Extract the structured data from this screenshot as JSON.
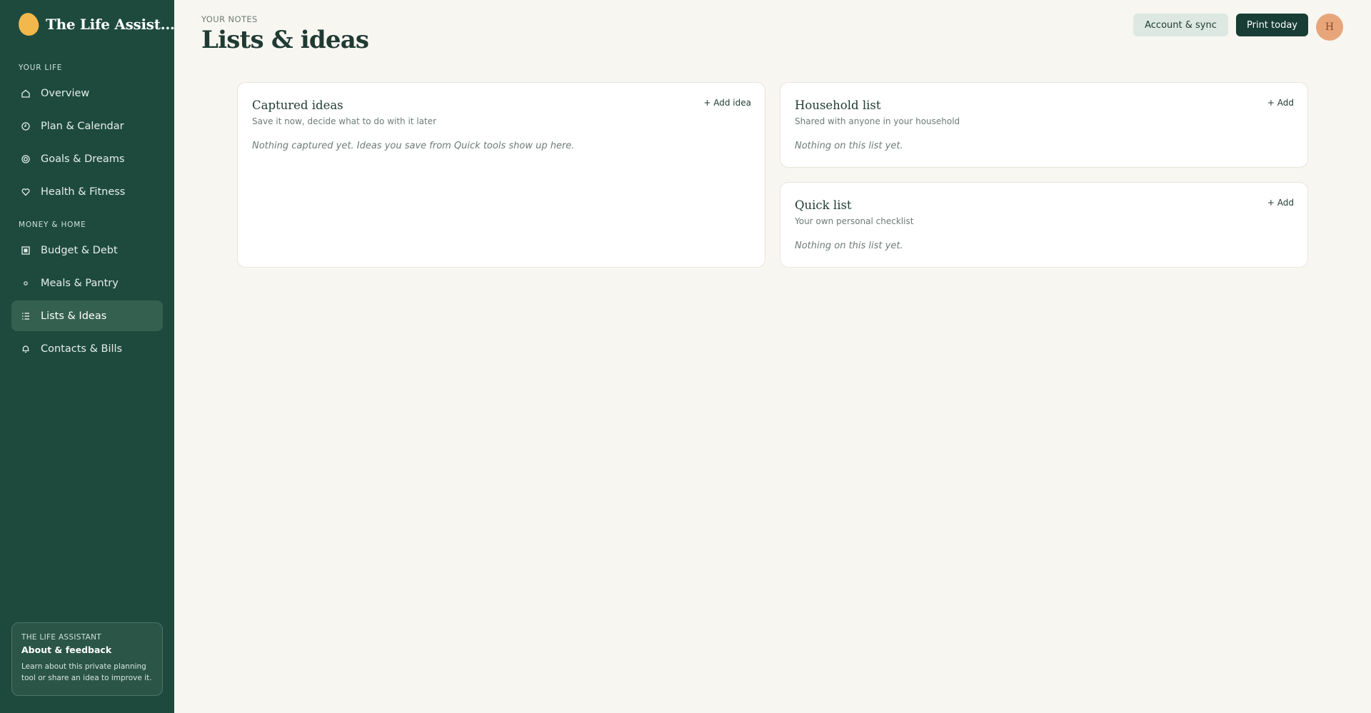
{
  "brand": {
    "name": "The Life Assist..."
  },
  "sidebar": {
    "section_life": "YOUR LIFE",
    "section_money": "MONEY & HOME",
    "items": [
      {
        "label": "Overview",
        "icon": "home-icon"
      },
      {
        "label": "Plan & Calendar",
        "icon": "clock-icon"
      },
      {
        "label": "Goals & Dreams",
        "icon": "target-icon"
      },
      {
        "label": "Health & Fitness",
        "icon": "heart-icon"
      },
      {
        "label": "Budget & Debt",
        "icon": "wallet-icon"
      },
      {
        "label": "Meals & Pantry",
        "icon": "circle-icon"
      },
      {
        "label": "Lists & Ideas",
        "icon": "list-icon",
        "active": true
      },
      {
        "label": "Contacts & Bills",
        "icon": "bell-icon"
      }
    ],
    "about": {
      "kicker": "THE LIFE ASSISTANT",
      "title": "About & feedback",
      "text": "Learn about this private planning tool or share an idea to improve it."
    }
  },
  "header": {
    "kicker": "YOUR NOTES",
    "title": "Lists & ideas",
    "account_label": "Account & sync",
    "print_label": "Print today",
    "avatar_initial": "H"
  },
  "cards": {
    "captured": {
      "title": "Captured ideas",
      "subtitle": "Save it now, decide what to do with it later",
      "empty": "Nothing captured yet. Ideas you save from Quick tools show up here.",
      "add_label": "+ Add idea"
    },
    "household": {
      "title": "Household list",
      "subtitle": "Shared with anyone in your household",
      "empty": "Nothing on this list yet.",
      "add_label": "+ Add"
    },
    "quick": {
      "title": "Quick list",
      "subtitle": "Your own personal checklist",
      "empty": "Nothing on this list yet.",
      "add_label": "+ Add"
    }
  },
  "colors": {
    "sidebar_bg": "#1e4a3e",
    "sidebar_active": "#34604f",
    "page_bg": "#f8f6f1",
    "accent_dark": "#173d34",
    "brand_logo": "#f2b84b",
    "avatar_bg": "#e8a57a"
  }
}
